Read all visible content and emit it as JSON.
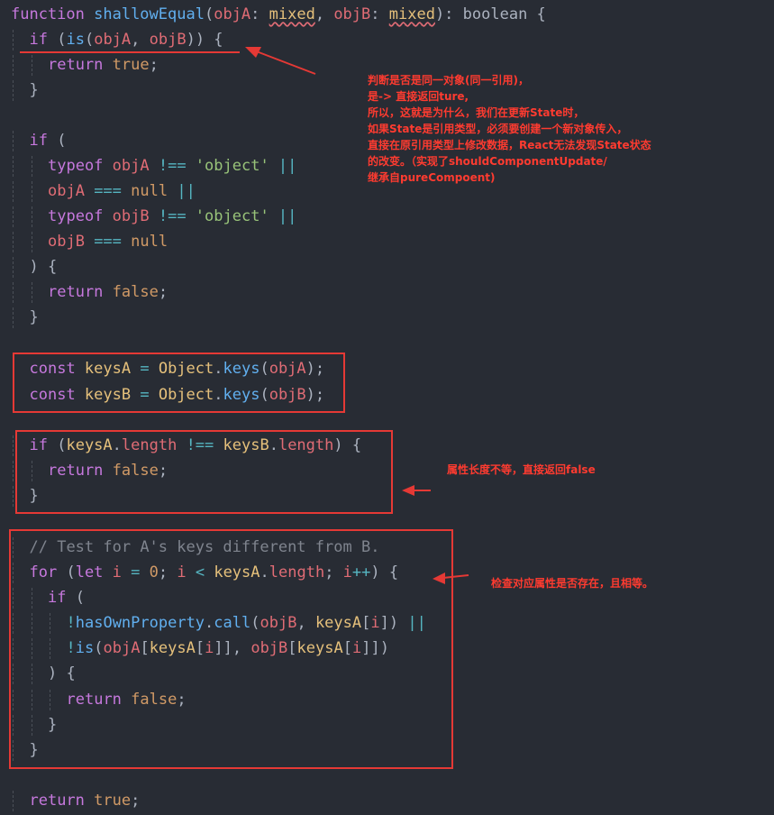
{
  "editor": {
    "lines": [
      [
        [
          "kw",
          "function "
        ],
        [
          "fn",
          "shallowEqual"
        ],
        [
          "pl",
          "("
        ],
        [
          "pa",
          "objA"
        ],
        [
          "pl",
          ": "
        ],
        [
          "ty",
          "mixed"
        ],
        [
          "pl",
          ", "
        ],
        [
          "pa",
          "objB"
        ],
        [
          "pl",
          ": "
        ],
        [
          "ty",
          "mixed"
        ],
        [
          "pl",
          "): "
        ],
        [
          "pl",
          "boolean"
        ],
        [
          "pl",
          " {"
        ]
      ],
      [
        [
          "kw",
          "if "
        ],
        [
          "pl",
          "("
        ],
        [
          "fn",
          "is"
        ],
        [
          "pl",
          "("
        ],
        [
          "pa",
          "objA"
        ],
        [
          "pl",
          ", "
        ],
        [
          "pa",
          "objB"
        ],
        [
          "pl",
          ")) {"
        ]
      ],
      [
        [
          "kw",
          "return "
        ],
        [
          "nu",
          "true"
        ],
        [
          "pl",
          ";"
        ]
      ],
      [
        [
          "pl",
          "}"
        ]
      ],
      [],
      [
        [
          "kw",
          "if "
        ],
        [
          "pl",
          "("
        ]
      ],
      [
        [
          "kw",
          "typeof "
        ],
        [
          "pa",
          "objA "
        ],
        [
          "op",
          "!== "
        ],
        [
          "st",
          "'object' "
        ],
        [
          "op",
          "||"
        ]
      ],
      [
        [
          "pa",
          "objA "
        ],
        [
          "op",
          "=== "
        ],
        [
          "nu",
          "null "
        ],
        [
          "op",
          "||"
        ]
      ],
      [
        [
          "kw",
          "typeof "
        ],
        [
          "pa",
          "objB "
        ],
        [
          "op",
          "!== "
        ],
        [
          "st",
          "'object' "
        ],
        [
          "op",
          "||"
        ]
      ],
      [
        [
          "pa",
          "objB "
        ],
        [
          "op",
          "=== "
        ],
        [
          "nu",
          "null"
        ]
      ],
      [
        [
          "pl",
          ") {"
        ]
      ],
      [
        [
          "kw",
          "return "
        ],
        [
          "nu",
          "false"
        ],
        [
          "pl",
          ";"
        ]
      ],
      [
        [
          "pl",
          "}"
        ]
      ],
      [],
      [
        [
          "kw",
          "const "
        ],
        [
          "ty",
          "keysA "
        ],
        [
          "op",
          "= "
        ],
        [
          "ty",
          "Object"
        ],
        [
          "pl",
          "."
        ],
        [
          "fn",
          "keys"
        ],
        [
          "pl",
          "("
        ],
        [
          "pa",
          "objA"
        ],
        [
          "pl",
          ");"
        ]
      ],
      [
        [
          "kw",
          "const "
        ],
        [
          "ty",
          "keysB "
        ],
        [
          "op",
          "= "
        ],
        [
          "ty",
          "Object"
        ],
        [
          "pl",
          "."
        ],
        [
          "fn",
          "keys"
        ],
        [
          "pl",
          "("
        ],
        [
          "pa",
          "objB"
        ],
        [
          "pl",
          ");"
        ]
      ],
      [],
      [
        [
          "kw",
          "if "
        ],
        [
          "pl",
          "("
        ],
        [
          "ty",
          "keysA"
        ],
        [
          "pl",
          "."
        ],
        [
          "pa",
          "length "
        ],
        [
          "op",
          "!== "
        ],
        [
          "ty",
          "keysB"
        ],
        [
          "pl",
          "."
        ],
        [
          "pa",
          "length"
        ],
        [
          "pl",
          ") {"
        ]
      ],
      [
        [
          "kw",
          "return "
        ],
        [
          "nu",
          "false"
        ],
        [
          "pl",
          ";"
        ]
      ],
      [
        [
          "pl",
          "}"
        ]
      ],
      [],
      [
        [
          "cm",
          "// Test for A's keys different from B."
        ]
      ],
      [
        [
          "kw",
          "for "
        ],
        [
          "pl",
          "("
        ],
        [
          "kw",
          "let "
        ],
        [
          "pa",
          "i "
        ],
        [
          "op",
          "= "
        ],
        [
          "nu",
          "0"
        ],
        [
          "pl",
          "; "
        ],
        [
          "pa",
          "i "
        ],
        [
          "op",
          "< "
        ],
        [
          "ty",
          "keysA"
        ],
        [
          "pl",
          "."
        ],
        [
          "pa",
          "length"
        ],
        [
          "pl",
          "; "
        ],
        [
          "pa",
          "i"
        ],
        [
          "op",
          "++"
        ],
        [
          "pl",
          ") {"
        ]
      ],
      [
        [
          "kw",
          "if "
        ],
        [
          "pl",
          "("
        ]
      ],
      [
        [
          "op",
          "!"
        ],
        [
          "fn",
          "hasOwnProperty"
        ],
        [
          "pl",
          "."
        ],
        [
          "fn",
          "call"
        ],
        [
          "pl",
          "("
        ],
        [
          "pa",
          "objB"
        ],
        [
          "pl",
          ", "
        ],
        [
          "ty",
          "keysA"
        ],
        [
          "pl",
          "["
        ],
        [
          "pa",
          "i"
        ],
        [
          "pl",
          "]) "
        ],
        [
          "op",
          "||"
        ]
      ],
      [
        [
          "op",
          "!"
        ],
        [
          "fn",
          "is"
        ],
        [
          "pl",
          "("
        ],
        [
          "pa",
          "objA"
        ],
        [
          "pl",
          "["
        ],
        [
          "ty",
          "keysA"
        ],
        [
          "pl",
          "["
        ],
        [
          "pa",
          "i"
        ],
        [
          "pl",
          "]], "
        ],
        [
          "pa",
          "objB"
        ],
        [
          "pl",
          "["
        ],
        [
          "ty",
          "keysA"
        ],
        [
          "pl",
          "["
        ],
        [
          "pa",
          "i"
        ],
        [
          "pl",
          "]])"
        ]
      ],
      [
        [
          "pl",
          ") {"
        ]
      ],
      [
        [
          "kw",
          "return "
        ],
        [
          "nu",
          "false"
        ],
        [
          "pl",
          ";"
        ]
      ],
      [
        [
          "pl",
          "}"
        ]
      ],
      [
        [
          "pl",
          "}"
        ]
      ],
      [],
      [
        [
          "kw",
          "return "
        ],
        [
          "nu",
          "true"
        ],
        [
          "pl",
          ";"
        ]
      ]
    ]
  },
  "annotations": {
    "note1": "判断是否是同一对象(同一引用)，\n是-> 直接返回ture,\n所以，这就是为什么，我们在更新State时，\n如果State是引用类型，必须要创建一个新对象传入，\n直接在原引用类型上修改数据，React无法发现State状态\n的改变。（实现了shouldComponentUpdate/\n继承自pureCompoent)",
    "note2": "属性长度不等，直接返回false",
    "note3": "检查对应属性是否存在，且相等。",
    "color": "#ff3b30"
  }
}
